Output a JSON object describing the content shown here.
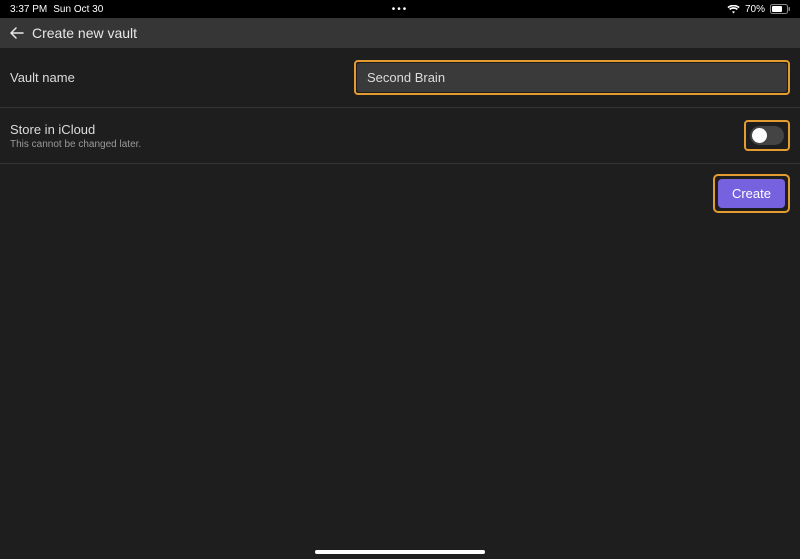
{
  "status_bar": {
    "time": "3:37 PM",
    "date": "Sun Oct 30",
    "ellipsis": "•••",
    "battery_pct": "70%"
  },
  "header": {
    "title": "Create new vault"
  },
  "form": {
    "vault_name_label": "Vault name",
    "vault_name_value": "Second Brain",
    "icloud_label": "Store in iCloud",
    "icloud_sublabel": "This cannot be changed later.",
    "create_button": "Create"
  }
}
